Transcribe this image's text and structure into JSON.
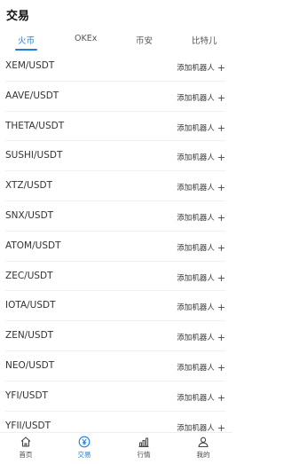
{
  "header": {
    "title": "交易"
  },
  "tabs": [
    {
      "label": "火币",
      "active": true
    },
    {
      "label": "OKEx",
      "active": false
    },
    {
      "label": "币安",
      "active": false
    },
    {
      "label": "比特儿",
      "active": false
    }
  ],
  "add_label": "添加机器人",
  "pairs": [
    "XEM/USDT",
    "AAVE/USDT",
    "THETA/USDT",
    "SUSHI/USDT",
    "XTZ/USDT",
    "SNX/USDT",
    "ATOM/USDT",
    "ZEC/USDT",
    "IOTA/USDT",
    "ZEN/USDT",
    "NEO/USDT",
    "YFI/USDT",
    "YFII/USDT"
  ],
  "bottom_nav": [
    {
      "label": "首页",
      "icon": "home-icon",
      "active": false
    },
    {
      "label": "交易",
      "icon": "yuan-circle-icon",
      "active": true
    },
    {
      "label": "行情",
      "icon": "bar-chart-icon",
      "active": false
    },
    {
      "label": "我的",
      "icon": "user-icon",
      "active": false
    }
  ],
  "colors": {
    "accent": "#1a7ee6",
    "text": "#333333",
    "divider": "#f1f1f1"
  }
}
